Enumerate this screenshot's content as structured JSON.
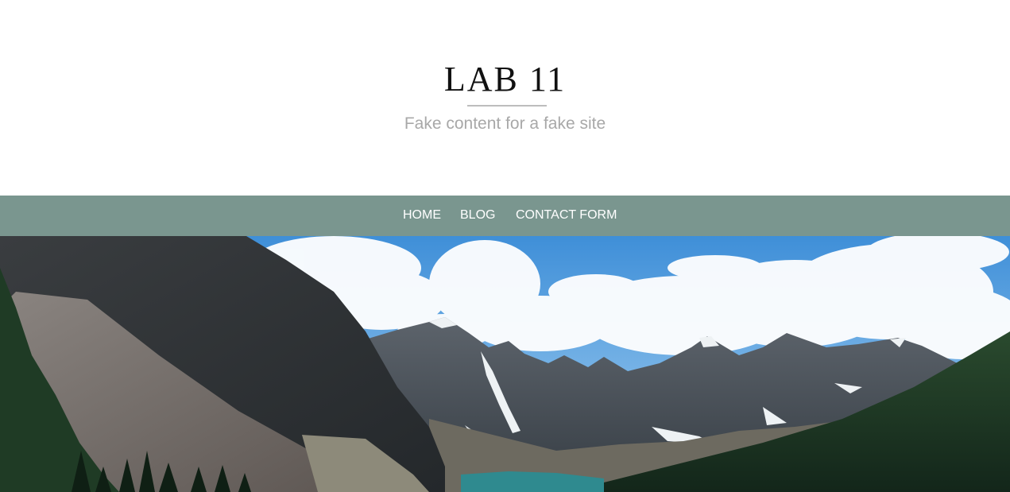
{
  "header": {
    "title": "LAB 11",
    "tagline": "Fake content for a fake site"
  },
  "nav": {
    "items": [
      {
        "label": "HOME"
      },
      {
        "label": "BLOG"
      },
      {
        "label": "CONTACT FORM"
      }
    ]
  },
  "colors": {
    "nav_background": "#7a968f",
    "nav_text": "#ffffff",
    "title_text": "#111111",
    "tagline_text": "#a8a8a8"
  },
  "hero": {
    "icon": "mountain-landscape-photo"
  }
}
